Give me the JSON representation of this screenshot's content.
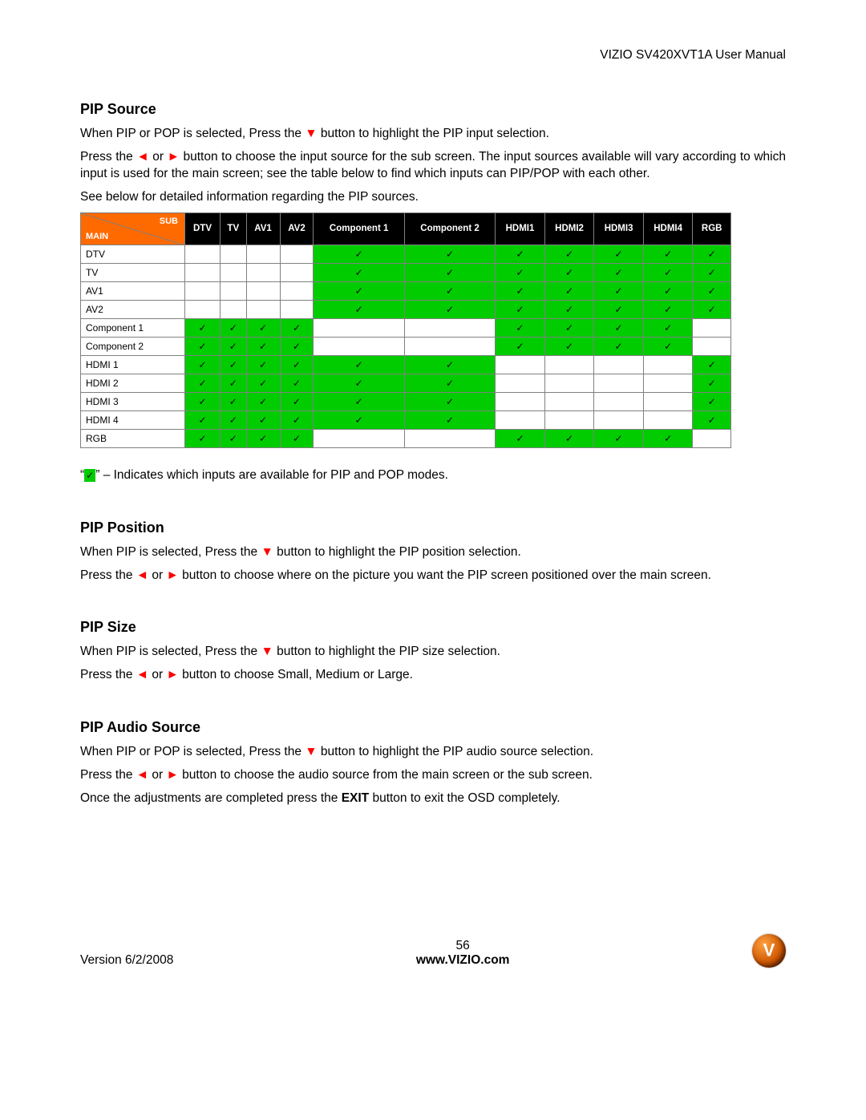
{
  "header": {
    "title": "VIZIO SV420XVT1A User Manual"
  },
  "sections": {
    "pipSource": {
      "heading": "PIP Source",
      "p1a": "When PIP or POP is selected, Press the ",
      "p1b": " button to highlight the PIP input selection.",
      "p2a": "Press the ",
      "p2b": " or ",
      "p2c": " button to choose the input source for the sub screen. The input sources available will vary according to which input is used for the main screen; see the table below to find which inputs can PIP/POP with each other.",
      "p3": "See below for detailed information regarding the PIP sources."
    },
    "legend": {
      "quote_open": "“",
      "check": "✓",
      "text": "” – Indicates which inputs are available for PIP and POP modes."
    },
    "pipPosition": {
      "heading": "PIP Position",
      "p1a": "When PIP is selected, Press the ",
      "p1b": " button to highlight the PIP position selection.",
      "p2a": "Press the ",
      "p2b": " or ",
      "p2c": " button to choose where on the picture you want the PIP screen positioned over the main screen."
    },
    "pipSize": {
      "heading": "PIP Size",
      "p1a": "When PIP is selected, Press the ",
      "p1b": " button to highlight the PIP size selection.",
      "p2a": "Press the ",
      "p2b": " or ",
      "p2c": " button to choose Small, Medium or Large."
    },
    "pipAudio": {
      "heading": "PIP Audio Source",
      "p1a": "When PIP or POP is selected, Press the ",
      "p1b": " button to highlight the PIP audio source selection.",
      "p2a": "Press the ",
      "p2b": " or ",
      "p2c": " button to choose the audio source from the main screen or the sub screen.",
      "p3a": "Once the adjustments are completed press the ",
      "p3bold": "EXIT",
      "p3b": " button to exit the OSD completely."
    }
  },
  "arrows": {
    "down": "▼",
    "left": "◄",
    "right": "►"
  },
  "table": {
    "cornerSub": "SUB",
    "cornerMain": "MAIN",
    "columns": [
      "DTV",
      "TV",
      "AV1",
      "AV2",
      "Component 1",
      "Component 2",
      "HDMI1",
      "HDMI2",
      "HDMI3",
      "HDMI4",
      "RGB"
    ],
    "rows": [
      "DTV",
      "TV",
      "AV1",
      "AV2",
      "Component 1",
      "Component 2",
      "HDMI 1",
      "HDMI 2",
      "HDMI 3",
      "HDMI 4",
      "RGB"
    ],
    "checkMark": "✓",
    "matrix": [
      [
        0,
        0,
        0,
        0,
        1,
        1,
        1,
        1,
        1,
        1,
        1
      ],
      [
        0,
        0,
        0,
        0,
        1,
        1,
        1,
        1,
        1,
        1,
        1
      ],
      [
        0,
        0,
        0,
        0,
        1,
        1,
        1,
        1,
        1,
        1,
        1
      ],
      [
        0,
        0,
        0,
        0,
        1,
        1,
        1,
        1,
        1,
        1,
        1
      ],
      [
        1,
        1,
        1,
        1,
        0,
        0,
        1,
        1,
        1,
        1,
        0
      ],
      [
        1,
        1,
        1,
        1,
        0,
        0,
        1,
        1,
        1,
        1,
        0
      ],
      [
        1,
        1,
        1,
        1,
        1,
        1,
        0,
        0,
        0,
        0,
        1
      ],
      [
        1,
        1,
        1,
        1,
        1,
        1,
        0,
        0,
        0,
        0,
        1
      ],
      [
        1,
        1,
        1,
        1,
        1,
        1,
        0,
        0,
        0,
        0,
        1
      ],
      [
        1,
        1,
        1,
        1,
        1,
        1,
        0,
        0,
        0,
        0,
        1
      ],
      [
        1,
        1,
        1,
        1,
        0,
        0,
        1,
        1,
        1,
        1,
        0
      ]
    ]
  },
  "footer": {
    "version": "Version 6/2/2008",
    "page": "56",
    "url": "www.VIZIO.com"
  }
}
